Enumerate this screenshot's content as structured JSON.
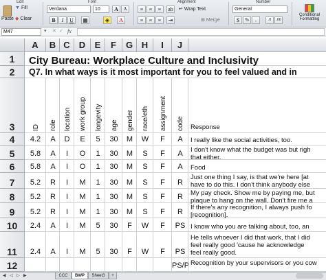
{
  "ribbon": {
    "groups": {
      "edit": "Edit",
      "font": "Font",
      "alignment": "Alignment",
      "number": "Number"
    },
    "paste_label": "Paste",
    "fill_label": "Fill",
    "clear_label": "Clear",
    "font_name": "Verdana",
    "font_size": "10",
    "wrap_text_label": "Wrap Text",
    "merge_label": "Merge",
    "number_format": "General",
    "conditional_formatting_label": "Conditional Formatting",
    "bold": "B",
    "italic": "I",
    "underline": "U"
  },
  "formula_bar": {
    "cell_ref": "M47",
    "fx": "fx",
    "value": ""
  },
  "columns": [
    "A",
    "B",
    "C",
    "D",
    "E",
    "F",
    "G",
    "H",
    "I",
    "J"
  ],
  "sheet": {
    "title": "City Bureau: Workplace Culture and Inclusivity",
    "question": "Q7. In what ways is it most important for you to feel valued and in",
    "headers": [
      "ID",
      "role",
      "location",
      "work group",
      "longevity",
      "age",
      "gender",
      "race/eth",
      "assignment",
      "code",
      "Response"
    ],
    "rows": [
      {
        "num": "4",
        "cells": [
          "4.2",
          "A",
          "D",
          "E",
          "5",
          "30",
          "M",
          "W",
          "F",
          "A"
        ],
        "response": [
          "I really like the social activities, too."
        ]
      },
      {
        "num": "5",
        "cells": [
          "5.8",
          "A",
          "I",
          "O",
          "1",
          "30",
          "M",
          "S",
          "F",
          "A"
        ],
        "response": [
          "I don't know what the budget was but righ",
          "that either."
        ]
      },
      {
        "num": "6",
        "cells": [
          "5.8",
          "A",
          "I",
          "O",
          "1",
          "30",
          "M",
          "S",
          "F",
          "A"
        ],
        "response": [
          "Food"
        ]
      },
      {
        "num": "7",
        "cells": [
          "5.2",
          "R",
          "I",
          "M",
          "1",
          "30",
          "M",
          "S",
          "F",
          "R"
        ],
        "response": [
          "Just one thing I say, is that we're here [at",
          "have to do this. I don't think anybody else"
        ]
      },
      {
        "num": "8",
        "cells": [
          "5.2",
          "R",
          "I",
          "M",
          "1",
          "30",
          "M",
          "S",
          "F",
          "R"
        ],
        "response": [
          "My pay check. Show me by paying me, but",
          "plaque to hang on the wall. Don't fire me a"
        ]
      },
      {
        "num": "9",
        "cells": [
          "5.2",
          "R",
          "I",
          "M",
          "1",
          "30",
          "M",
          "S",
          "F",
          "R"
        ],
        "response": [
          "If there's any recognition, I always push fo",
          "[recognition]."
        ]
      },
      {
        "num": "10",
        "cells": [
          "2.4",
          "A",
          "I",
          "M",
          "5",
          "30",
          "F",
          "W",
          "F",
          "PS"
        ],
        "response": [
          "I know who you are talking about, too, an"
        ]
      },
      {
        "num": "11",
        "cells": [
          "2.4",
          "A",
          "I",
          "M",
          "5",
          "30",
          "F",
          "W",
          "F",
          "PS"
        ],
        "response": [
          "He tells whoever I did that work, that I did",
          "feel really good 'cause he acknowledge",
          "feel really good."
        ]
      },
      {
        "num": "12",
        "cells": [
          "",
          "",
          "",
          "",
          "",
          "",
          "",
          "",
          "",
          "PS/P"
        ],
        "response": [
          "Recognition by your supervisors or you cow"
        ]
      }
    ]
  },
  "tabs": [
    "CCC",
    "BWP",
    "Sheet3",
    "+"
  ],
  "active_tab": "BWP"
}
